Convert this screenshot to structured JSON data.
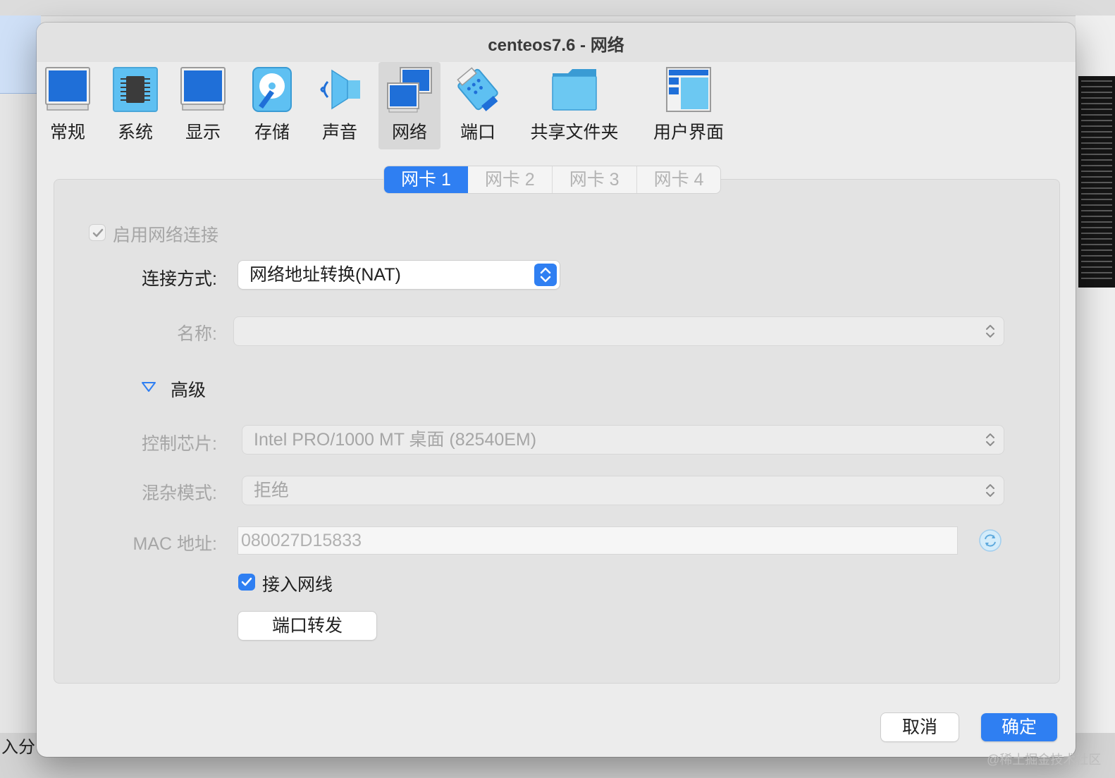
{
  "window": {
    "title": "centeos7.6 - 网络"
  },
  "toolbar": {
    "items": [
      {
        "label": "常规",
        "icon": "monitor-icon"
      },
      {
        "label": "系统",
        "icon": "chip-icon"
      },
      {
        "label": "显示",
        "icon": "display-icon"
      },
      {
        "label": "存储",
        "icon": "disk-icon"
      },
      {
        "label": "声音",
        "icon": "speaker-icon"
      },
      {
        "label": "网络",
        "icon": "network-icon",
        "selected": true
      },
      {
        "label": "端口",
        "icon": "serial-port-icon"
      },
      {
        "label": "共享文件夹",
        "icon": "folder-icon"
      },
      {
        "label": "用户界面",
        "icon": "window-layout-icon"
      }
    ]
  },
  "tabs": [
    "网卡 1",
    "网卡 2",
    "网卡 3",
    "网卡 4"
  ],
  "active_tab": "网卡 1",
  "form": {
    "enable_label": "启用网络连接",
    "attach_label": "连接方式:",
    "attach_value": "网络地址转换(NAT)",
    "name_label": "名称:",
    "name_value": "",
    "advanced_label": "高级",
    "adapter_label": "控制芯片:",
    "adapter_value": "Intel PRO/1000 MT 桌面 (82540EM)",
    "promisc_label": "混杂模式:",
    "promisc_value": "拒绝",
    "mac_label": "MAC 地址:",
    "mac_value": "080027D15833",
    "cable_label": "接入网线",
    "cable_checked": true,
    "port_forward_label": "端口转发"
  },
  "buttons": {
    "cancel": "取消",
    "ok": "确定"
  },
  "background": {
    "bottom_fragment": "入分"
  },
  "watermark": "@稀土掘金技术社区",
  "colors": {
    "accent": "#2f7ff2",
    "icon_blue": "#1f6fd8",
    "icon_light": "#5ec0f2"
  }
}
